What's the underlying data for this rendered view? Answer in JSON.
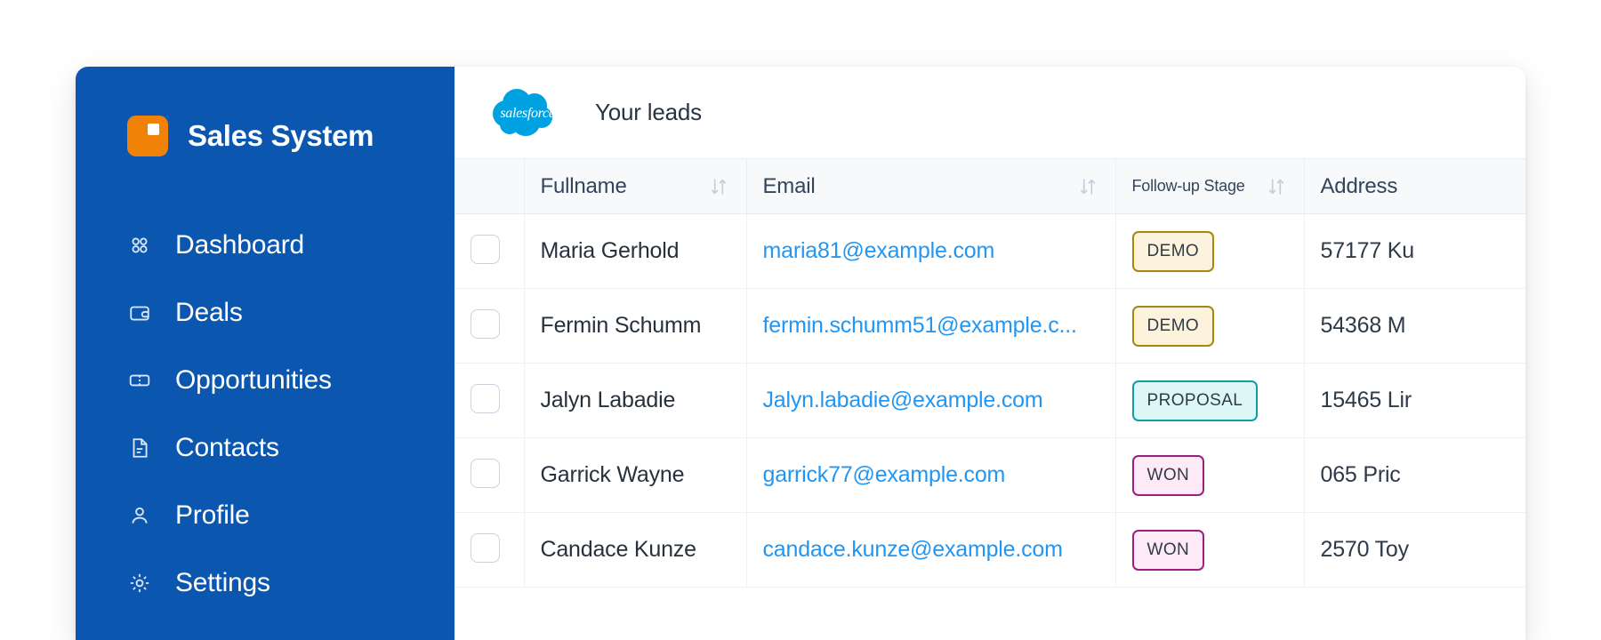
{
  "sidebar": {
    "brand": {
      "title": "Sales System",
      "mark_color": "#f08307",
      "background": "#0b57b0"
    },
    "items": [
      {
        "label": "Dashboard",
        "icon": "grid-dots-icon"
      },
      {
        "label": "Deals",
        "icon": "wallet-icon"
      },
      {
        "label": "Opportunities",
        "icon": "ticket-icon"
      },
      {
        "label": "Contacts",
        "icon": "document-icon"
      },
      {
        "label": "Profile",
        "icon": "user-icon"
      },
      {
        "label": "Settings",
        "icon": "gear-icon"
      }
    ]
  },
  "topbar": {
    "logo": "salesforce-cloud-logo",
    "logo_text": "salesforce",
    "title": "Your leads"
  },
  "table": {
    "columns": [
      {
        "label": "",
        "sortable": false,
        "name": "select"
      },
      {
        "label": "Fullname",
        "sortable": true,
        "name": "fullname"
      },
      {
        "label": "Email",
        "sortable": true,
        "name": "email"
      },
      {
        "label": "Follow-up Stage",
        "sortable": true,
        "name": "followup-stage",
        "small": true
      },
      {
        "label": "Address",
        "sortable": true,
        "name": "address"
      }
    ],
    "rows": [
      {
        "checked": false,
        "fullname": "Maria Gerhold",
        "email": "maria81@example.com",
        "stage": "DEMO",
        "stage_class": "demo",
        "address": "57177 Ku"
      },
      {
        "checked": false,
        "fullname": "Fermin Schumm",
        "email": "fermin.schumm51@example.c...",
        "stage": "DEMO",
        "stage_class": "demo",
        "address": "54368 M"
      },
      {
        "checked": false,
        "fullname": "Jalyn Labadie",
        "email": "Jalyn.labadie@example.com",
        "stage": "PROPOSAL",
        "stage_class": "proposal",
        "address": "15465 Lir"
      },
      {
        "checked": false,
        "fullname": "Garrick Wayne",
        "email": "garrick77@example.com",
        "stage": "WON",
        "stage_class": "won",
        "address": "065 Pric"
      },
      {
        "checked": false,
        "fullname": "Candace Kunze",
        "email": "candace.kunze@example.com",
        "stage": "WON",
        "stage_class": "won",
        "address": "2570 Toy"
      }
    ]
  },
  "colors": {
    "sidebar_blue": "#0b57b0",
    "brand_orange": "#f08307",
    "link_blue": "#2196f3",
    "salesforce_cloud": "#00a1e0",
    "badge_demo_border": "#a8860f",
    "badge_demo_fill": "#fdf3dd",
    "badge_proposal_border": "#119da4",
    "badge_proposal_fill": "#ddf7f6",
    "badge_won_border": "#9b1f7e",
    "badge_won_fill": "#fdeaf6"
  }
}
